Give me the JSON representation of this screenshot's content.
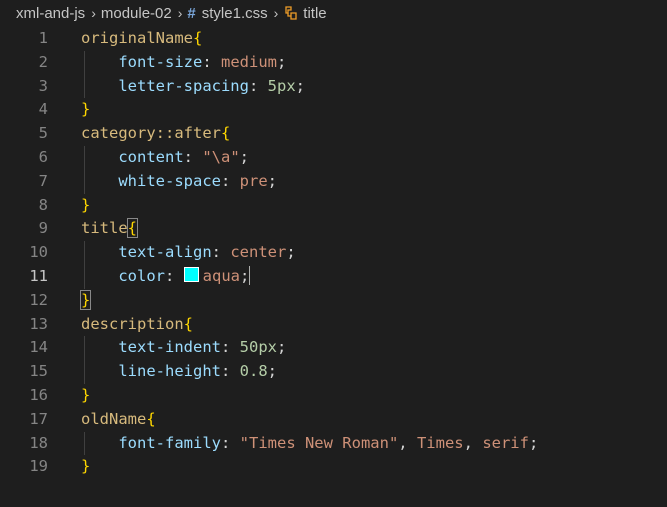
{
  "breadcrumb": {
    "folder": "xml-and-js",
    "subfolder": "module-02",
    "file": "style1.css",
    "symbol": "title"
  },
  "colors": {
    "swatch": "#00ffff",
    "selector": "#d7ba7d",
    "property": "#9cdcfe",
    "value": "#ce9178",
    "number": "#b5cea8",
    "brace": "#ffd700"
  },
  "code": {
    "lines": [
      {
        "n": "1",
        "sel": "originalName",
        "brace": "{"
      },
      {
        "n": "2",
        "prop": "font-size",
        "sep": ": ",
        "val": "medium",
        "end": ";"
      },
      {
        "n": "3",
        "prop": "letter-spacing",
        "sep": ": ",
        "num": "5px",
        "end": ";"
      },
      {
        "n": "4",
        "brace": "}"
      },
      {
        "n": "5",
        "sel": "category::after",
        "brace": "{"
      },
      {
        "n": "6",
        "prop": "content",
        "sep": ": ",
        "str": "\"\\a\"",
        "end": ";"
      },
      {
        "n": "7",
        "prop": "white-space",
        "sep": ": ",
        "val": "pre",
        "end": ";"
      },
      {
        "n": "8",
        "brace": "}"
      },
      {
        "n": "9",
        "sel": "title",
        "brace": "{"
      },
      {
        "n": "10",
        "prop": "text-align",
        "sep": ": ",
        "val": "center",
        "end": ";"
      },
      {
        "n": "11",
        "prop": "color",
        "sep": ": ",
        "val": "aqua",
        "end": ";"
      },
      {
        "n": "12",
        "brace": "}"
      },
      {
        "n": "13",
        "sel": "description",
        "brace": "{"
      },
      {
        "n": "14",
        "prop": "text-indent",
        "sep": ": ",
        "num": "50px",
        "end": ";"
      },
      {
        "n": "15",
        "prop": "line-height",
        "sep": ": ",
        "num": "0.8",
        "end": ";"
      },
      {
        "n": "16",
        "brace": "}"
      },
      {
        "n": "17",
        "sel": "oldName",
        "brace": "{"
      },
      {
        "n": "18",
        "prop": "font-family",
        "sep": ": ",
        "str": "\"Times New Roman\"",
        "mid1": ", ",
        "val": "Times",
        "mid2": ", ",
        "val2": "serif",
        "end": ";"
      },
      {
        "n": "19",
        "brace": "}"
      }
    ]
  }
}
